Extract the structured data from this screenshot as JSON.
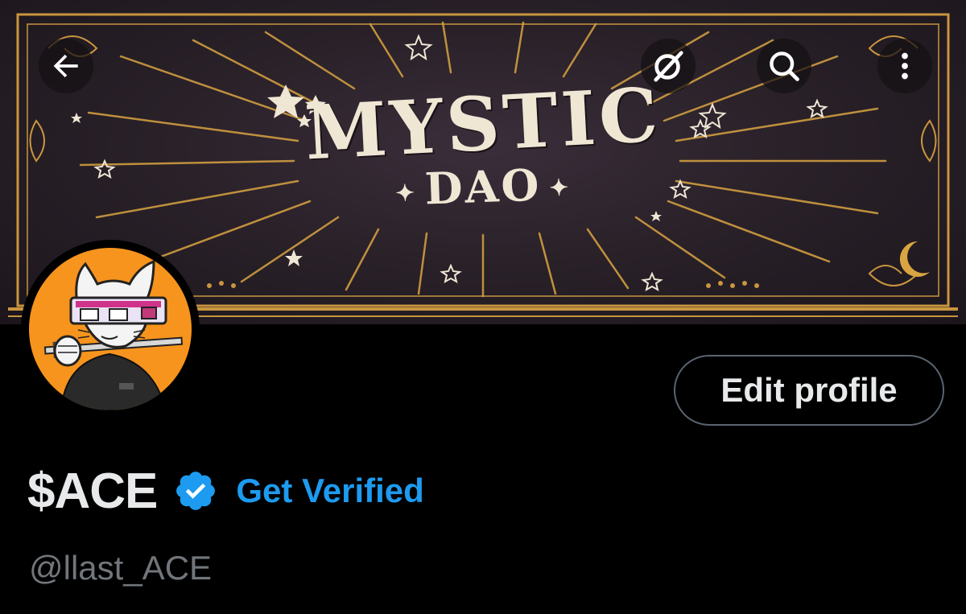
{
  "header": {
    "back_icon": "arrow-left-icon",
    "grok_icon": "grok-icon",
    "search_icon": "search-icon",
    "more_icon": "more-vertical-icon"
  },
  "banner": {
    "title": "MYSTIC",
    "subtitle": "DAO",
    "colors": {
      "background": "#2a2129",
      "lettering": "#efe6d4",
      "gold": "#d9a441"
    }
  },
  "profile": {
    "avatar_bg": "#f7941d",
    "display_name": "$ACE",
    "verified_icon": "verified-badge-icon",
    "get_verified_label": "Get Verified",
    "handle": "@llast_ACE",
    "edit_profile_label": "Edit profile"
  },
  "colors": {
    "accent": "#1d9bf0",
    "text_primary": "#e7e9ea",
    "text_secondary": "#71767b",
    "background": "#000000"
  }
}
